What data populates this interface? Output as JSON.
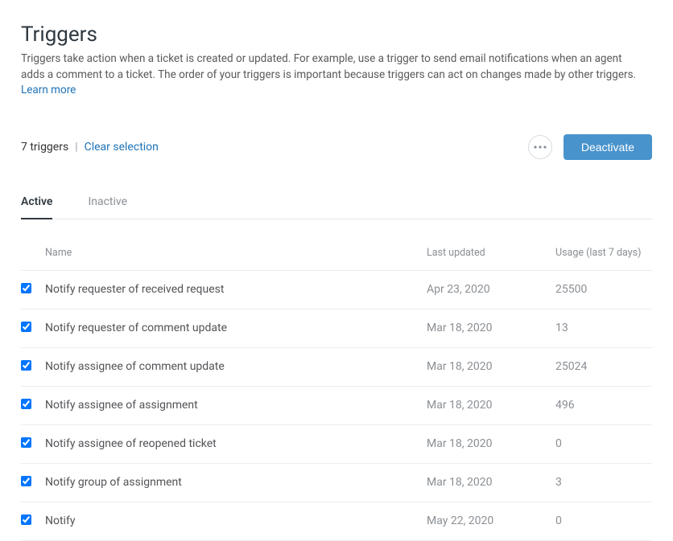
{
  "header": {
    "title": "Triggers",
    "description_1": "Triggers take action when a ticket is created or updated. For example, use a trigger to send email notifications when an agent adds a comment to a ticket. The order of your triggers is important because triggers can act on changes made by other triggers. ",
    "learn_more": "Learn more"
  },
  "toolbar": {
    "count": "7 triggers",
    "clear": "Clear selection",
    "deactivate": "Deactivate"
  },
  "tabs": {
    "active": "Active",
    "inactive": "Inactive"
  },
  "table": {
    "headers": {
      "name": "Name",
      "last_updated": "Last updated",
      "usage": "Usage (last 7 days)"
    },
    "rows": [
      {
        "name": "Notify requester of received request",
        "updated": "Apr 23, 2020",
        "usage": "25500"
      },
      {
        "name": "Notify requester of comment update",
        "updated": "Mar 18, 2020",
        "usage": "13"
      },
      {
        "name": "Notify assignee of comment update",
        "updated": "Mar 18, 2020",
        "usage": "25024"
      },
      {
        "name": "Notify assignee of assignment",
        "updated": "Mar 18, 2020",
        "usage": "496"
      },
      {
        "name": "Notify assignee of reopened ticket",
        "updated": "Mar 18, 2020",
        "usage": "0"
      },
      {
        "name": "Notify group of assignment",
        "updated": "Mar 18, 2020",
        "usage": "3"
      },
      {
        "name": "Notify",
        "updated": "May 22, 2020",
        "usage": "0"
      }
    ]
  }
}
